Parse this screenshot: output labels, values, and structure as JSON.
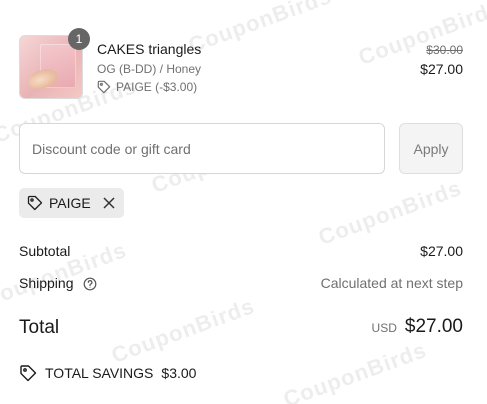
{
  "product": {
    "quantity": "1",
    "name": "CAKES triangles",
    "variant": "OG (B-DD) / Honey",
    "discount_line": "PAIGE (-$3.00)",
    "original_price": "$30.00",
    "price": "$27.00"
  },
  "discount": {
    "placeholder": "Discount code or gift card",
    "apply_label": "Apply",
    "applied_code": "PAIGE"
  },
  "summary": {
    "subtotal_label": "Subtotal",
    "subtotal_value": "$27.00",
    "shipping_label": "Shipping",
    "shipping_value": "Calculated at next step",
    "total_label": "Total",
    "currency": "USD",
    "total_value": "$27.00",
    "savings_label": "TOTAL SAVINGS",
    "savings_value": "$3.00"
  },
  "watermark": "CouponBirds",
  "icons": {
    "tag": "tag-icon",
    "close": "close-icon",
    "help": "help-circle-icon",
    "savings_tag": "savings-tag-icon"
  }
}
